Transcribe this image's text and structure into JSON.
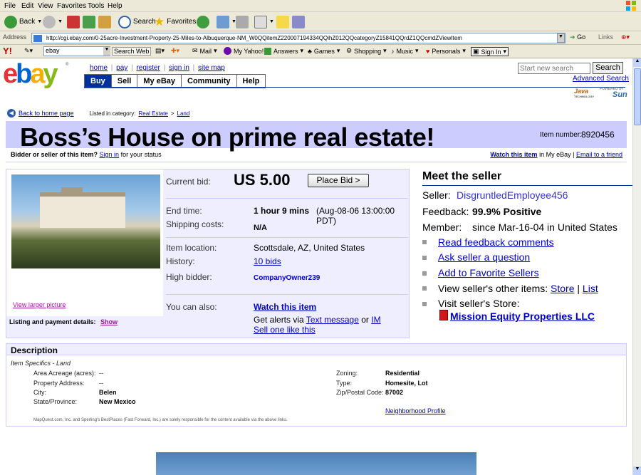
{
  "menubar": {
    "items": [
      "File",
      "Edit",
      "View",
      "Favorites",
      "Tools",
      "Help"
    ]
  },
  "toolbar": {
    "back": "Back",
    "search": "Search",
    "favorites": "Favorites"
  },
  "address": {
    "label": "Address",
    "url": "http://cgi.ebay.com/0-25acre-Investment-Property-25-Miles-to-Albuquerque-NM_W0QQitemZ220007194334QQihZ012QQcategoryZ15841QQrdZ1QQcmdZViewItem",
    "go": "Go",
    "links": "Links"
  },
  "yahoo": {
    "search_value": "ebay",
    "search_web": "Search Web",
    "mail": "Mail",
    "my_yahoo": "My Yahoo!",
    "answers": "Answers",
    "games": "Games",
    "shopping": "Shopping",
    "music": "Music",
    "personals": "Personals",
    "sign_in": "Sign In"
  },
  "ebay": {
    "logo": "ebay",
    "nav_links": [
      "home",
      "pay",
      "register",
      "sign in",
      "site map"
    ],
    "tabs": [
      "Buy",
      "Sell",
      "My eBay",
      "Community",
      "Help"
    ],
    "search_placeholder": "Start new search",
    "search_button": "Search",
    "advanced_search": "Advanced Search",
    "java_badge": "Java",
    "java_sub": "TECHNOLOGY",
    "sun_powered": "POWERED BY",
    "sun_badge": "Sun",
    "back_link": "Back to home page",
    "listed_in": "Listed in category:",
    "cat1": "Real Estate",
    "cat_sep": ">",
    "cat2": "Land",
    "title": "Boss’s House on prime real estate!",
    "item_number_label": "Item number:",
    "item_number": "8920456",
    "bidder_q": "Bidder or seller of this item?",
    "bidder_signin": "Sign in",
    "bidder_suffix": "for your status",
    "watch_item": "Watch this item",
    "watch_suffix": "in My eBay |",
    "email_friend": "Email to a friend",
    "view_larger": "View larger picture",
    "listing_details": "Listing and payment details:",
    "show": "Show"
  },
  "item": {
    "current_bid_label": "Current bid:",
    "current_bid": "US 5.00",
    "place_bid": "Place Bid >",
    "end_time_label": "End time:",
    "end_time": "1 hour 9 mins",
    "end_time_detail": "(Aug-08-06 13:00:00 PDT)",
    "shipping_label": "Shipping costs:",
    "shipping": "N/A",
    "location_label": "Item location:",
    "location": "Scottsdale, AZ, United States",
    "history_label": "History:",
    "history": "10 bids",
    "high_bidder_label": "High bidder:",
    "high_bidder": "CompanyOwner239",
    "can_also_label": "You can also:",
    "watch": "Watch this item",
    "alerts_prefix": "Get alerts via",
    "text_message": "Text message",
    "or": "or",
    "im": "IM",
    "sell_one": "Sell one like this"
  },
  "seller": {
    "heading": "Meet the seller",
    "seller_label": "Seller:",
    "seller_name": "DisgruntledEmployee456",
    "feedback_label": "Feedback:",
    "feedback_value": "99.9% Positive",
    "member_label": "Member:",
    "member_value": "since Mar-16-04 in United States",
    "read_feedback": "Read feedback comments",
    "ask_question": "Ask seller a question",
    "add_favorite": "Add to Favorite Sellers",
    "other_items": "View seller's other items:",
    "store": "Store",
    "sep": "|",
    "list": "List",
    "visit_store": "Visit seller's Store:",
    "store_name": "Mission Equity Properties LLC"
  },
  "description": {
    "heading": "Description",
    "specifics": "Item Specifics - Land",
    "area_label": "Area Acreage (acres):",
    "area": "--",
    "address_label": "Property Address:",
    "address": "--",
    "city_label": "City:",
    "city": "Belen",
    "state_label": "State/Province:",
    "state": "New Mexico",
    "zoning_label": "Zoning:",
    "zoning": "Residential",
    "type_label": "Type:",
    "type": "Homesite, Lot",
    "zip_label": "Zip/Postal Code:",
    "zip": "87002",
    "neighborhood": "Neighborhood Profile",
    "disclaimer": "MapQuest.com, Inc. and Sperling's BestPlaces (Fast Forward, Inc.) are solely responsible for the content available via the above links."
  },
  "colors": {
    "title_band": "#ccccff",
    "nav_blue": "#00309c",
    "link": "#0000cc",
    "item_bg": "#eeeeff"
  }
}
